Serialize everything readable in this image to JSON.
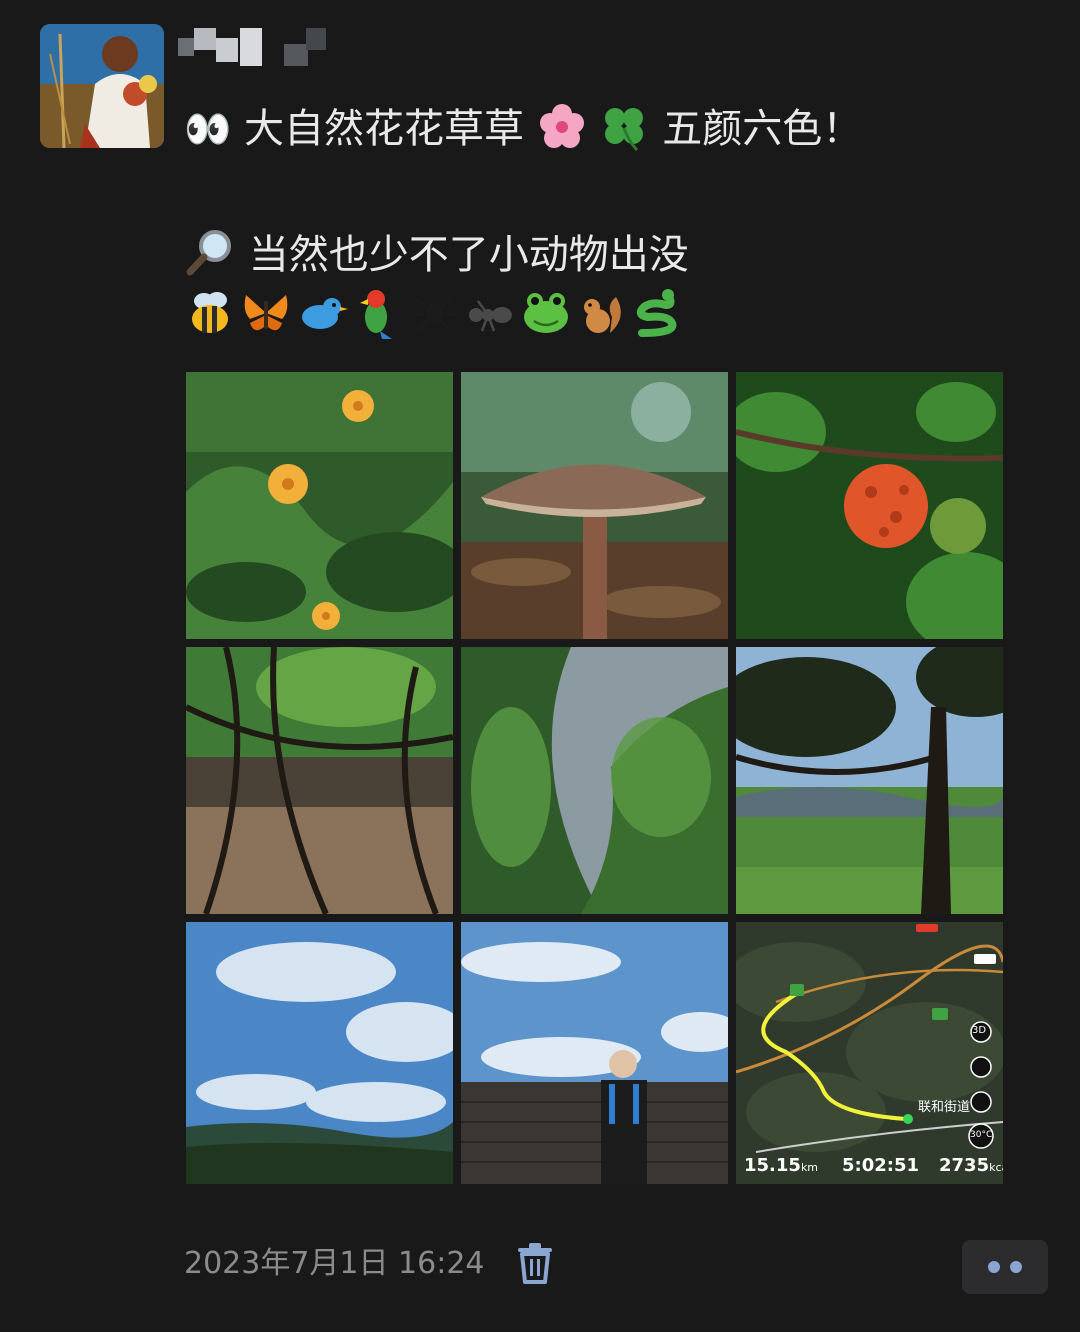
{
  "post": {
    "line1_emoji": "👀",
    "line1_text_a": "大自然花花草草",
    "line1_text_b": "五颜六色！",
    "line2_icon": "🔎",
    "line2_text": "当然也少不了小动物出没",
    "animal_icons": [
      "bee-icon",
      "butterfly-icon",
      "bird-icon",
      "parrot-icon",
      "spider-icon",
      "ant-icon",
      "frog-icon",
      "squirrel-icon",
      "snake-icon"
    ],
    "flower_icons": [
      "cherry-blossom-icon",
      "clover-icon"
    ]
  },
  "photos": [
    {
      "name": "photo-orange-flowers"
    },
    {
      "name": "photo-mushroom"
    },
    {
      "name": "photo-red-fruit"
    },
    {
      "name": "photo-tree-roots"
    },
    {
      "name": "photo-sky-through-foliage"
    },
    {
      "name": "photo-tree-over-valley"
    },
    {
      "name": "photo-clouds-over-hills"
    },
    {
      "name": "photo-person-at-wall"
    },
    {
      "name": "photo-route-map"
    }
  ],
  "map": {
    "distance": "15.15",
    "distance_unit": "km",
    "duration": "5:02:51",
    "calories": "2735",
    "calories_unit": "kcal",
    "place_label": "联和街道",
    "temperature": "30°C",
    "badge_3d": "3D"
  },
  "footer": {
    "timestamp": "2023年7月1日 16:24"
  },
  "colors": {
    "background": "#191919",
    "text": "#e9e9e9",
    "muted": "#8b8b8b",
    "link_blue": "#8ba6d3"
  }
}
